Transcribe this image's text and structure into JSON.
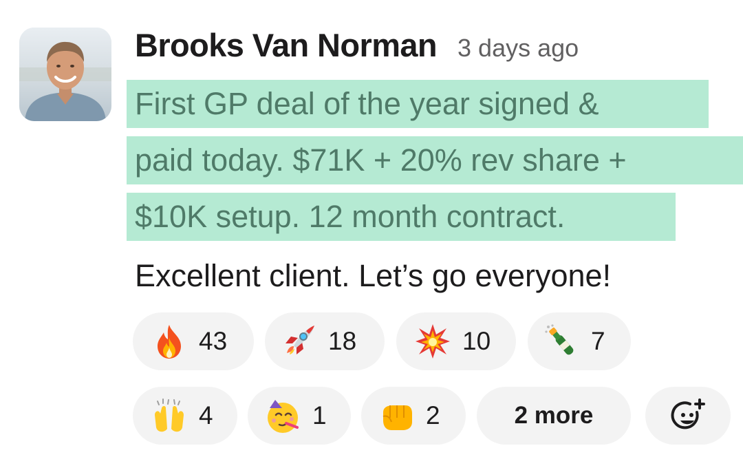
{
  "message": {
    "author": "Brooks Van Norman",
    "timestamp": "3 days ago",
    "highlighted_lines": [
      "First GP deal of the year signed &",
      "paid today. $71K + 20% rev share +",
      "$10K setup. 12 month contract."
    ],
    "plain_line": "Excellent client. Let’s go everyone!",
    "highlight_color": "#b5ead3",
    "highlight_text_color": "#4f7a68"
  },
  "reactions": [
    {
      "icon": "fire-emoji-icon",
      "count": "43"
    },
    {
      "icon": "rocket-emoji-icon",
      "count": "18"
    },
    {
      "icon": "collision-emoji-icon",
      "count": "10"
    },
    {
      "icon": "champagne-emoji-icon",
      "count": "7"
    },
    {
      "icon": "raised-hands-emoji-icon",
      "count": "4"
    },
    {
      "icon": "partying-face-emoji-icon",
      "count": "1"
    },
    {
      "icon": "fist-bump-emoji-icon",
      "count": "2"
    }
  ],
  "more_reactions_label": "2 more",
  "add_reaction_icon": "add-reaction-icon",
  "reaction_pill_color": "#f3f3f3"
}
